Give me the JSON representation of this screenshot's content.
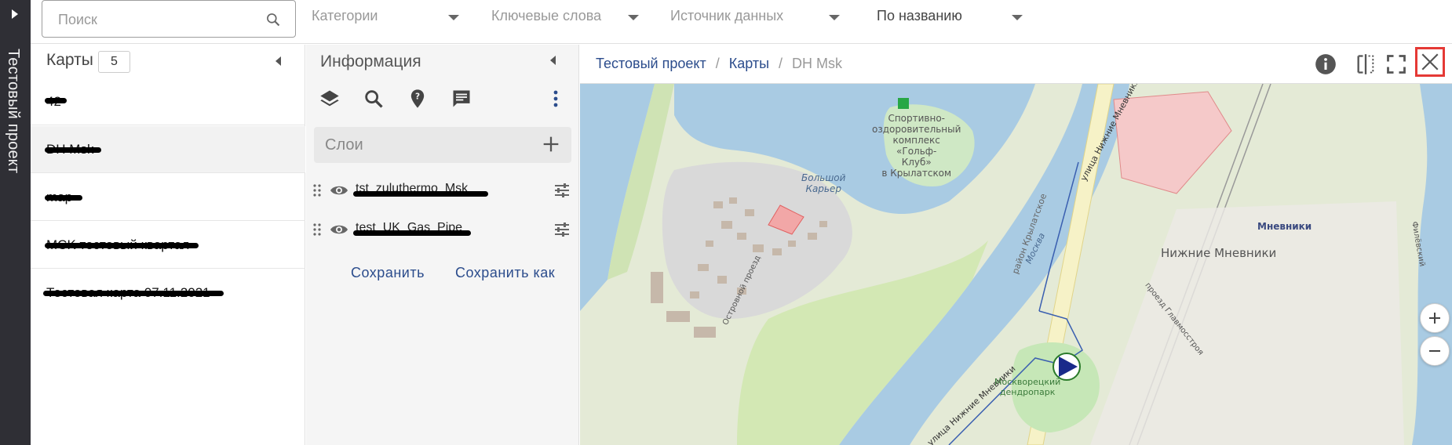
{
  "project": {
    "name": "Тестовый проект"
  },
  "filters": {
    "search_placeholder": "Поиск",
    "categories": "Категории",
    "keywords": "Ключевые слова",
    "data_source": "Источник данных",
    "sort": "По названию"
  },
  "maps": {
    "title": "Карты",
    "count": "5",
    "items": [
      {
        "label": "42"
      },
      {
        "label": "DH Msk"
      },
      {
        "label": "map"
      },
      {
        "label": "MCK тестовый квартал"
      },
      {
        "label": "Тестовая карта 07.11.2021"
      }
    ]
  },
  "info": {
    "title": "Информация",
    "layers_label": "Слои",
    "layers": [
      {
        "name": "tst_zuluthermo_Msk"
      },
      {
        "name": "test_UK_Gas_Pipe"
      }
    ],
    "save_label": "Сохранить",
    "save_as_label": "Сохранить как"
  },
  "map": {
    "breadcrumb": [
      "Тестовый проект",
      "Карты",
      "DH Msk"
    ],
    "labels": {
      "sport": "Спортивно-\nоздоровительный\nкомплекс\n«Гольф-\nКлуб»\nв Крылатском",
      "karier": "Большой\nКарьер",
      "mnevniki": "Мневники",
      "nizhnie": "Нижние Мневники",
      "street1": "улица Нижние Мневники",
      "street2": "улица Нижние Мневники",
      "district": "район Крылатское",
      "moskva": "Москва",
      "ostrovnoy": "Островной проезд",
      "proezd": "проезд Главмосстроя",
      "dendropark": "Москворецкий\nдендропарк",
      "filevsky": "Филёвский"
    }
  },
  "icons": {
    "search": "search-icon",
    "layers": "layers-icon",
    "info": "info-icon",
    "split": "split-view-icon",
    "fullscreen": "fullscreen-icon",
    "close": "close-icon"
  },
  "colors": {
    "link": "#2b4c8c",
    "close_border": "#e53935",
    "sidebar": "#2f2f35"
  }
}
